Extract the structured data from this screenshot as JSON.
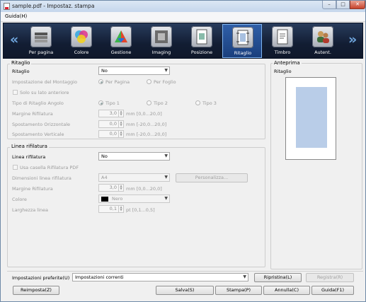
{
  "window": {
    "title": "sample.pdf - Impostaz. stampa",
    "min": "–",
    "max": "□",
    "close": "✕"
  },
  "menu": {
    "help": "Guida(H)"
  },
  "toolbar": {
    "items": [
      {
        "label": "Per pagina",
        "icon": "pages-icon"
      },
      {
        "label": "Colore",
        "icon": "color-icon"
      },
      {
        "label": "Gestione",
        "icon": "color-management-icon"
      },
      {
        "label": "Imaging",
        "icon": "imaging-icon"
      },
      {
        "label": "Posizione",
        "icon": "position-icon"
      },
      {
        "label": "Ritaglio",
        "icon": "crop-icon",
        "selected": true
      },
      {
        "label": "Timbro",
        "icon": "stamp-icon"
      },
      {
        "label": "Autent.",
        "icon": "authentication-icon"
      }
    ],
    "left_arrow": "«",
    "right_arrow": "»"
  },
  "ritaglio": {
    "group_title": "Ritaglio",
    "label": "Ritaglio",
    "value": "No",
    "montaggio_label": "Impostazione del Montaggio",
    "per_pagina": "Per Pagina",
    "per_foglio": "Per Foglio",
    "solo_lato": "Solo su lato anteriore",
    "tipo_label": "Tipo di Ritaglio Angolo",
    "tipo1": "Tipo 1",
    "tipo2": "Tipo 2",
    "tipo3": "Tipo 3",
    "margine_label": "Margine Rifilatura",
    "margine_value": "3,0",
    "margine_range": "mm [0,0...20,0]",
    "orizz_label": "Spostamento Orizzontale",
    "orizz_value": "0,0",
    "orizz_range": "mm [-20,0...20,0]",
    "vert_label": "Spostamento Verticale",
    "vert_value": "0,0",
    "vert_range": "mm [-20,0...20,0]"
  },
  "linea": {
    "group_title": "Linea rifilatura",
    "label": "Linea rifilatura",
    "value": "No",
    "usa_casella": "Usa casella Rifilatura PDF",
    "dimensioni_label": "Dimensioni linea rifilatura",
    "dimensioni_value": "A4",
    "personalizza": "Personalizza...",
    "margine_label": "Margine Rifilatura",
    "margine_value": "3,0",
    "margine_range": "mm [0,0...20,0]",
    "colore_label": "Colore",
    "colore_value": "Nero",
    "colore_hex": "#000000",
    "larghezza_label": "Larghezza linea",
    "larghezza_value": "0,1",
    "larghezza_range": "pt [0,1...0,5]"
  },
  "anteprima": {
    "group_title": "Anteprima",
    "label": "Ritaglio"
  },
  "bottom": {
    "pref_label": "Impostazioni preferite(U)",
    "pref_value": "Impostazioni correnti",
    "ripristina": "Ripristina(L)",
    "registra": "Registra(R)",
    "reimposta": "Reimposta(Z)",
    "salva": "Salva(S)",
    "stampa": "Stampa(P)",
    "annulla": "Annulla(C)",
    "guida": "Guida(F1)"
  }
}
